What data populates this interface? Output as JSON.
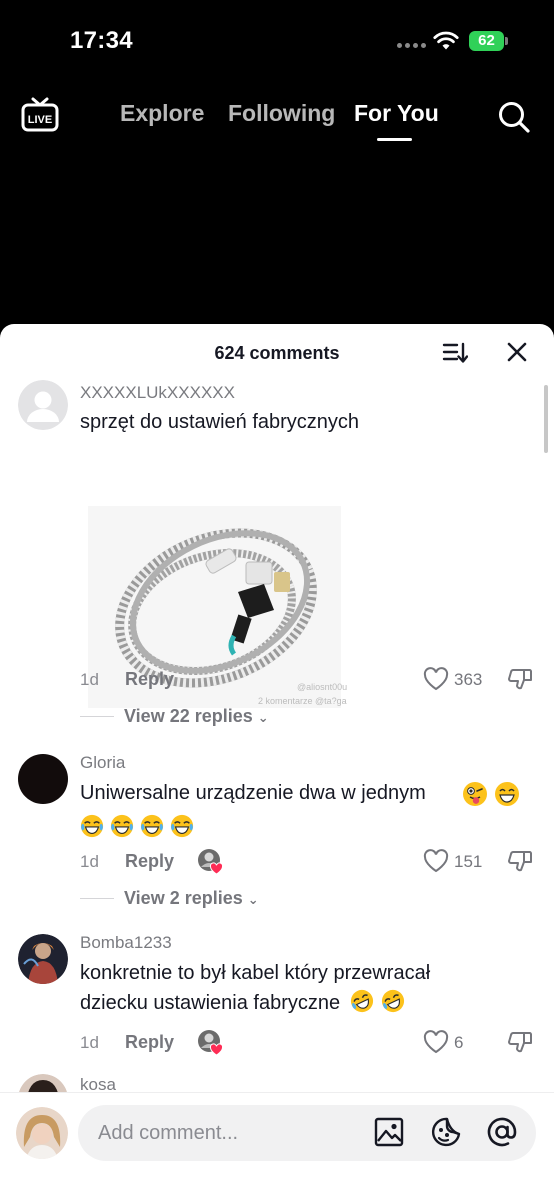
{
  "status_bar": {
    "time": "17:34",
    "battery": "62"
  },
  "top_nav": {
    "tabs": [
      "Explore",
      "Following",
      "For You"
    ],
    "active_tab": "For You",
    "live_label": "LIVE"
  },
  "comments_sheet": {
    "title": "624 comments",
    "comments": [
      {
        "username": "XXXXXLUkXXXXXX",
        "text": "sprzęt do ustawień fabrycznych",
        "image_watermark_1": "@aliosnt00u",
        "image_watermark_2": "2 komentarze @ta?ga",
        "time": "1d",
        "reply": "Reply",
        "likes": "363",
        "view_replies": "View 22 replies"
      },
      {
        "username": "Gloria",
        "text": "Uniwersalne urządzenie dwa w jednym",
        "time": "1d",
        "reply": "Reply",
        "likes": "151",
        "view_replies": "View 2 replies"
      },
      {
        "username": "Bomba1233",
        "text": "konkretnie to był kabel który przewracał dziecku ustawienia fabryczne",
        "time": "1d",
        "reply": "Reply",
        "likes": "6"
      },
      {
        "username": "kosa"
      }
    ]
  },
  "input": {
    "placeholder": "Add comment..."
  },
  "colors": {
    "accent_red": "#fe2c55",
    "battery_green": "#30d158",
    "text_primary": "#161823",
    "text_secondary": "#75767c"
  }
}
